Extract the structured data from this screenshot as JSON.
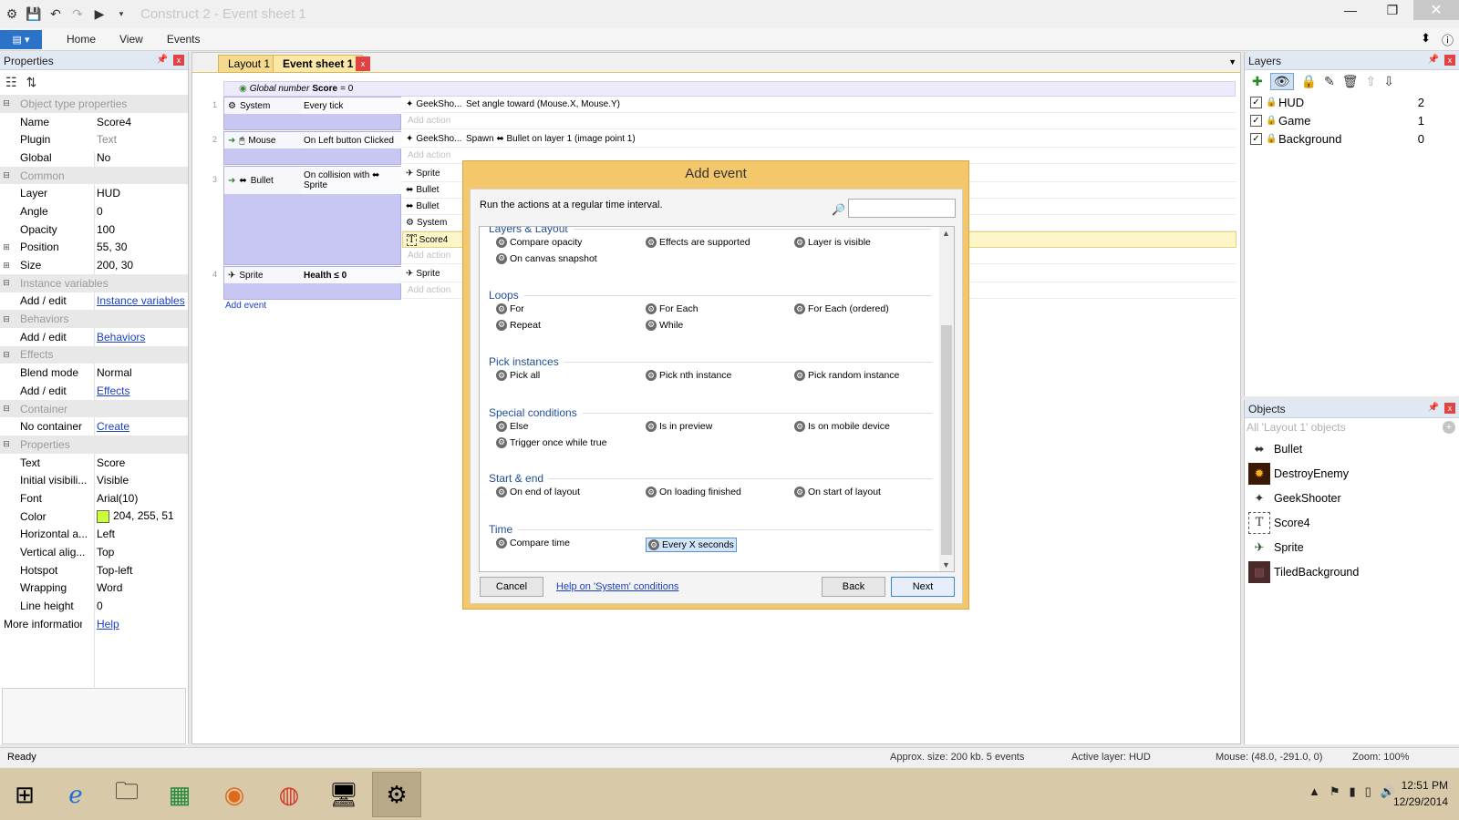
{
  "window": {
    "title": "Construct 2 - Event sheet 1"
  },
  "ribbon": {
    "file_label": "▤ ▾",
    "tabs": [
      "Home",
      "View",
      "Events"
    ]
  },
  "properties": {
    "title": "Properties",
    "rows": [
      {
        "kind": "cat",
        "name": "Object type properties"
      },
      {
        "kind": "prop",
        "name": "Name",
        "value": "Score4"
      },
      {
        "kind": "prop",
        "name": "Plugin",
        "value": "Text",
        "disabled": true
      },
      {
        "kind": "prop",
        "name": "Global",
        "value": "No"
      },
      {
        "kind": "cat",
        "name": "Common"
      },
      {
        "kind": "prop",
        "name": "Layer",
        "value": "HUD"
      },
      {
        "kind": "prop",
        "name": "Angle",
        "value": "0"
      },
      {
        "kind": "prop",
        "name": "Opacity",
        "value": "100"
      },
      {
        "kind": "prop",
        "name": "Position",
        "value": "55, 30",
        "expand": true
      },
      {
        "kind": "prop",
        "name": "Size",
        "value": "200, 30",
        "expand": true
      },
      {
        "kind": "cat",
        "name": "Instance variables"
      },
      {
        "kind": "prop",
        "name": "Add / edit",
        "value": "Instance variables",
        "link": true
      },
      {
        "kind": "cat",
        "name": "Behaviors"
      },
      {
        "kind": "prop",
        "name": "Add / edit",
        "value": "Behaviors",
        "link": true
      },
      {
        "kind": "cat",
        "name": "Effects"
      },
      {
        "kind": "prop",
        "name": "Blend mode",
        "value": "Normal"
      },
      {
        "kind": "prop",
        "name": "Add / edit",
        "value": "Effects",
        "link": true
      },
      {
        "kind": "cat",
        "name": "Container"
      },
      {
        "kind": "prop",
        "name": "No container",
        "value": "Create",
        "link": true
      },
      {
        "kind": "cat",
        "name": "Properties"
      },
      {
        "kind": "prop",
        "name": "Text",
        "value": "Score"
      },
      {
        "kind": "prop",
        "name": "Initial visibili...",
        "value": "Visible"
      },
      {
        "kind": "prop",
        "name": "Font",
        "value": "Arial(10)"
      },
      {
        "kind": "prop",
        "name": "Color",
        "value": "204, 255, 51",
        "swatch": "#ccff33"
      },
      {
        "kind": "prop",
        "name": "Horizontal a...",
        "value": "Left"
      },
      {
        "kind": "prop",
        "name": "Vertical alig...",
        "value": "Top"
      },
      {
        "kind": "prop",
        "name": "Hotspot",
        "value": "Top-left"
      },
      {
        "kind": "prop",
        "name": "Wrapping",
        "value": "Word"
      },
      {
        "kind": "prop",
        "name": "Line height",
        "value": "0"
      },
      {
        "kind": "more",
        "name": "More information",
        "value": "Help",
        "link": true
      }
    ]
  },
  "editor": {
    "tabs": {
      "layout": "Layout 1",
      "event_sheet": "Event sheet 1",
      "close": "x"
    },
    "global_var": {
      "prefix": "Global number",
      "name": "Score",
      "suffix": "= 0"
    },
    "events": [
      {
        "num": "1",
        "object": "System",
        "condition": "Every tick",
        "actions": [
          {
            "object": "GeekSho...",
            "desc": "Set angle toward (Mouse.X, Mouse.Y)"
          }
        ]
      },
      {
        "num": "2",
        "object": "Mouse",
        "condition": "On Left button Clicked",
        "actions": [
          {
            "object": "GeekSho...",
            "desc": "Spawn ⬌ Bullet on layer 1 (image point 1)"
          }
        ]
      },
      {
        "num": "3",
        "object": "Bullet",
        "condition": "On collision with ⬌ Sprite",
        "actions": [
          {
            "object": "Sprite",
            "desc": ""
          },
          {
            "object": "Bullet",
            "desc": ""
          },
          {
            "object": "Bullet",
            "desc": ""
          },
          {
            "object": "System",
            "desc": ""
          },
          {
            "object": "Score4",
            "desc": ""
          }
        ]
      },
      {
        "num": "4",
        "object": "Sprite",
        "condition": "Health ≤ 0",
        "actions": [
          {
            "object": "Sprite",
            "desc": ""
          }
        ]
      }
    ],
    "add_action": "Add action",
    "add_event": "Add event"
  },
  "dialog": {
    "title": "Add event",
    "description": "Run the actions at a regular time interval.",
    "search_placeholder": "",
    "groups": [
      {
        "name": "Layers & Layout",
        "items": [
          "Compare opacity",
          "Effects are supported",
          "Layer is visible",
          "On canvas snapshot"
        ]
      },
      {
        "name": "Loops",
        "items": [
          "For",
          "For Each",
          "For Each (ordered)",
          "Repeat",
          "While"
        ]
      },
      {
        "name": "Pick instances",
        "items": [
          "Pick all",
          "Pick nth instance",
          "Pick random instance"
        ]
      },
      {
        "name": "Special conditions",
        "items": [
          "Else",
          "Is in preview",
          "Is on mobile device",
          "Trigger once while true"
        ]
      },
      {
        "name": "Start & end",
        "items": [
          "On end of layout",
          "On loading finished",
          "On start of layout"
        ]
      },
      {
        "name": "Time",
        "items": [
          "Compare time",
          "Every X seconds"
        ]
      }
    ],
    "selected": "Every X seconds",
    "buttons": {
      "cancel": "Cancel",
      "help": "Help on 'System' conditions",
      "back": "Back",
      "next": "Next"
    }
  },
  "layers": {
    "title": "Layers",
    "items": [
      {
        "name": "HUD",
        "index": "2"
      },
      {
        "name": "Game",
        "index": "1"
      },
      {
        "name": "Background",
        "index": "0"
      }
    ]
  },
  "objects": {
    "title": "Objects",
    "filter": "All 'Layout 1' objects",
    "items": [
      "Bullet",
      "DestroyEnemy",
      "GeekShooter",
      "Score4",
      "Sprite",
      "TiledBackground"
    ]
  },
  "status": {
    "ready": "Ready",
    "size": "Approx. size: 200 kb. 5 events",
    "layer": "Active layer: HUD",
    "mouse": "Mouse: (48.0, -291.0, 0)",
    "zoom": "Zoom: 100%"
  },
  "taskbar": {
    "time": "12:51 PM",
    "date": "12/29/2014"
  },
  "colors": {
    "accent": "#f3c76a",
    "condition_bg": "#c8c6f2",
    "file_button": "#2b73c9",
    "close_red": "#e04343"
  }
}
